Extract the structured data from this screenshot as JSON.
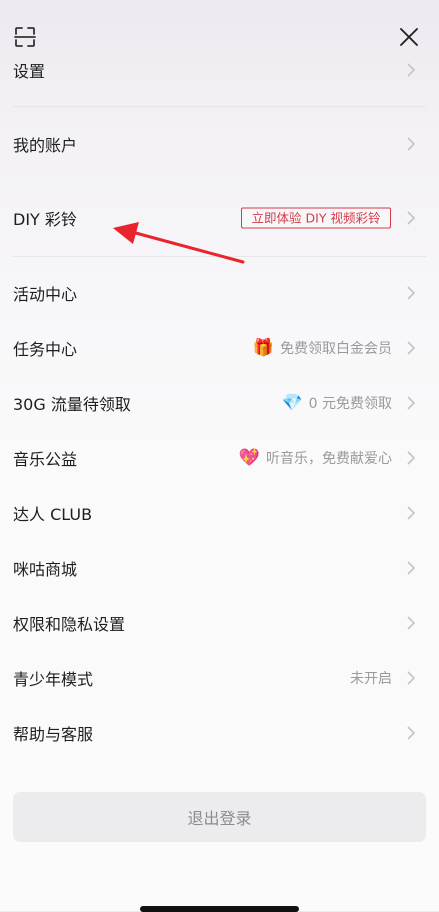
{
  "header": {
    "scan_icon": "scan-icon",
    "close_icon": "close-icon"
  },
  "menu": {
    "settings": "设置",
    "account": "我的账户",
    "diy": {
      "label": "DIY 彩铃",
      "badge": "立即体验 DIY 视频彩铃"
    },
    "activity": "活动中心",
    "tasks": {
      "label": "任务中心",
      "hint": "免费领取白金会员",
      "hint_icon": "🎁"
    },
    "traffic": {
      "label": "30G 流量待领取",
      "hint": "0 元免费领取",
      "hint_icon": "💎"
    },
    "charity": {
      "label": "音乐公益",
      "hint": "听音乐，免费献爱心",
      "hint_icon": "💖"
    },
    "club": "达人 CLUB",
    "mall": "咪咕商城",
    "privacy": "权限和隐私设置",
    "teen": {
      "label": "青少年模式",
      "status": "未开启"
    },
    "help": "帮助与客服"
  },
  "logout_label": "退出登录",
  "colors": {
    "badge": "#d63a48",
    "arrow": "#e8242c",
    "chevron": "#c4c4c4",
    "logout_bg": "#ececef"
  }
}
